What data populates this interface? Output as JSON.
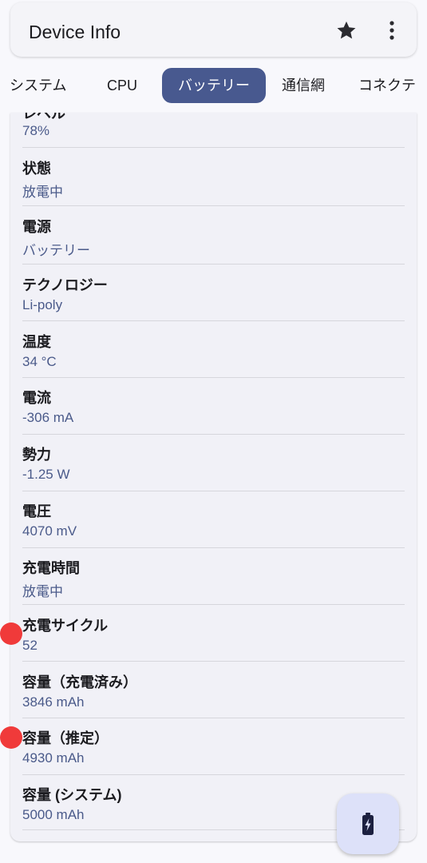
{
  "appbar": {
    "title": "Device Info",
    "star_icon": "star-icon",
    "more_icon": "more-vert-icon"
  },
  "tabs": [
    {
      "label": "システム"
    },
    {
      "label": "CPU"
    },
    {
      "label": "バッテリー",
      "active": true
    },
    {
      "label": "通信網"
    },
    {
      "label": "コネクテ"
    }
  ],
  "battery": {
    "partial_label": "レベル",
    "items": [
      {
        "label": "",
        "value": "78%"
      },
      {
        "label": "状態",
        "value": "放電中"
      },
      {
        "label": "電源",
        "value": "バッテリー"
      },
      {
        "label": "テクノロジー",
        "value": "Li-poly"
      },
      {
        "label": "温度",
        "value": "34 °C"
      },
      {
        "label": "電流",
        "value": "-306 mA"
      },
      {
        "label": "勢力",
        "value": "-1.25 W"
      },
      {
        "label": "電圧",
        "value": "4070 mV"
      },
      {
        "label": "充電時間",
        "value": "放電中"
      },
      {
        "label": "充電サイクル",
        "value": "52"
      },
      {
        "label": "容量（充電済み）",
        "value": "3846 mAh"
      },
      {
        "label": "容量（推定）",
        "value": "4930 mAh"
      },
      {
        "label": "容量 (システム)",
        "value": "5000 mAh"
      }
    ]
  },
  "fab": {
    "icon": "battery-charging-icon"
  },
  "colors": {
    "accent": "#48598f",
    "value_text": "#4a5a8a",
    "touch_indicator": "#f03a3a",
    "fab_bg": "#dde1f9"
  }
}
